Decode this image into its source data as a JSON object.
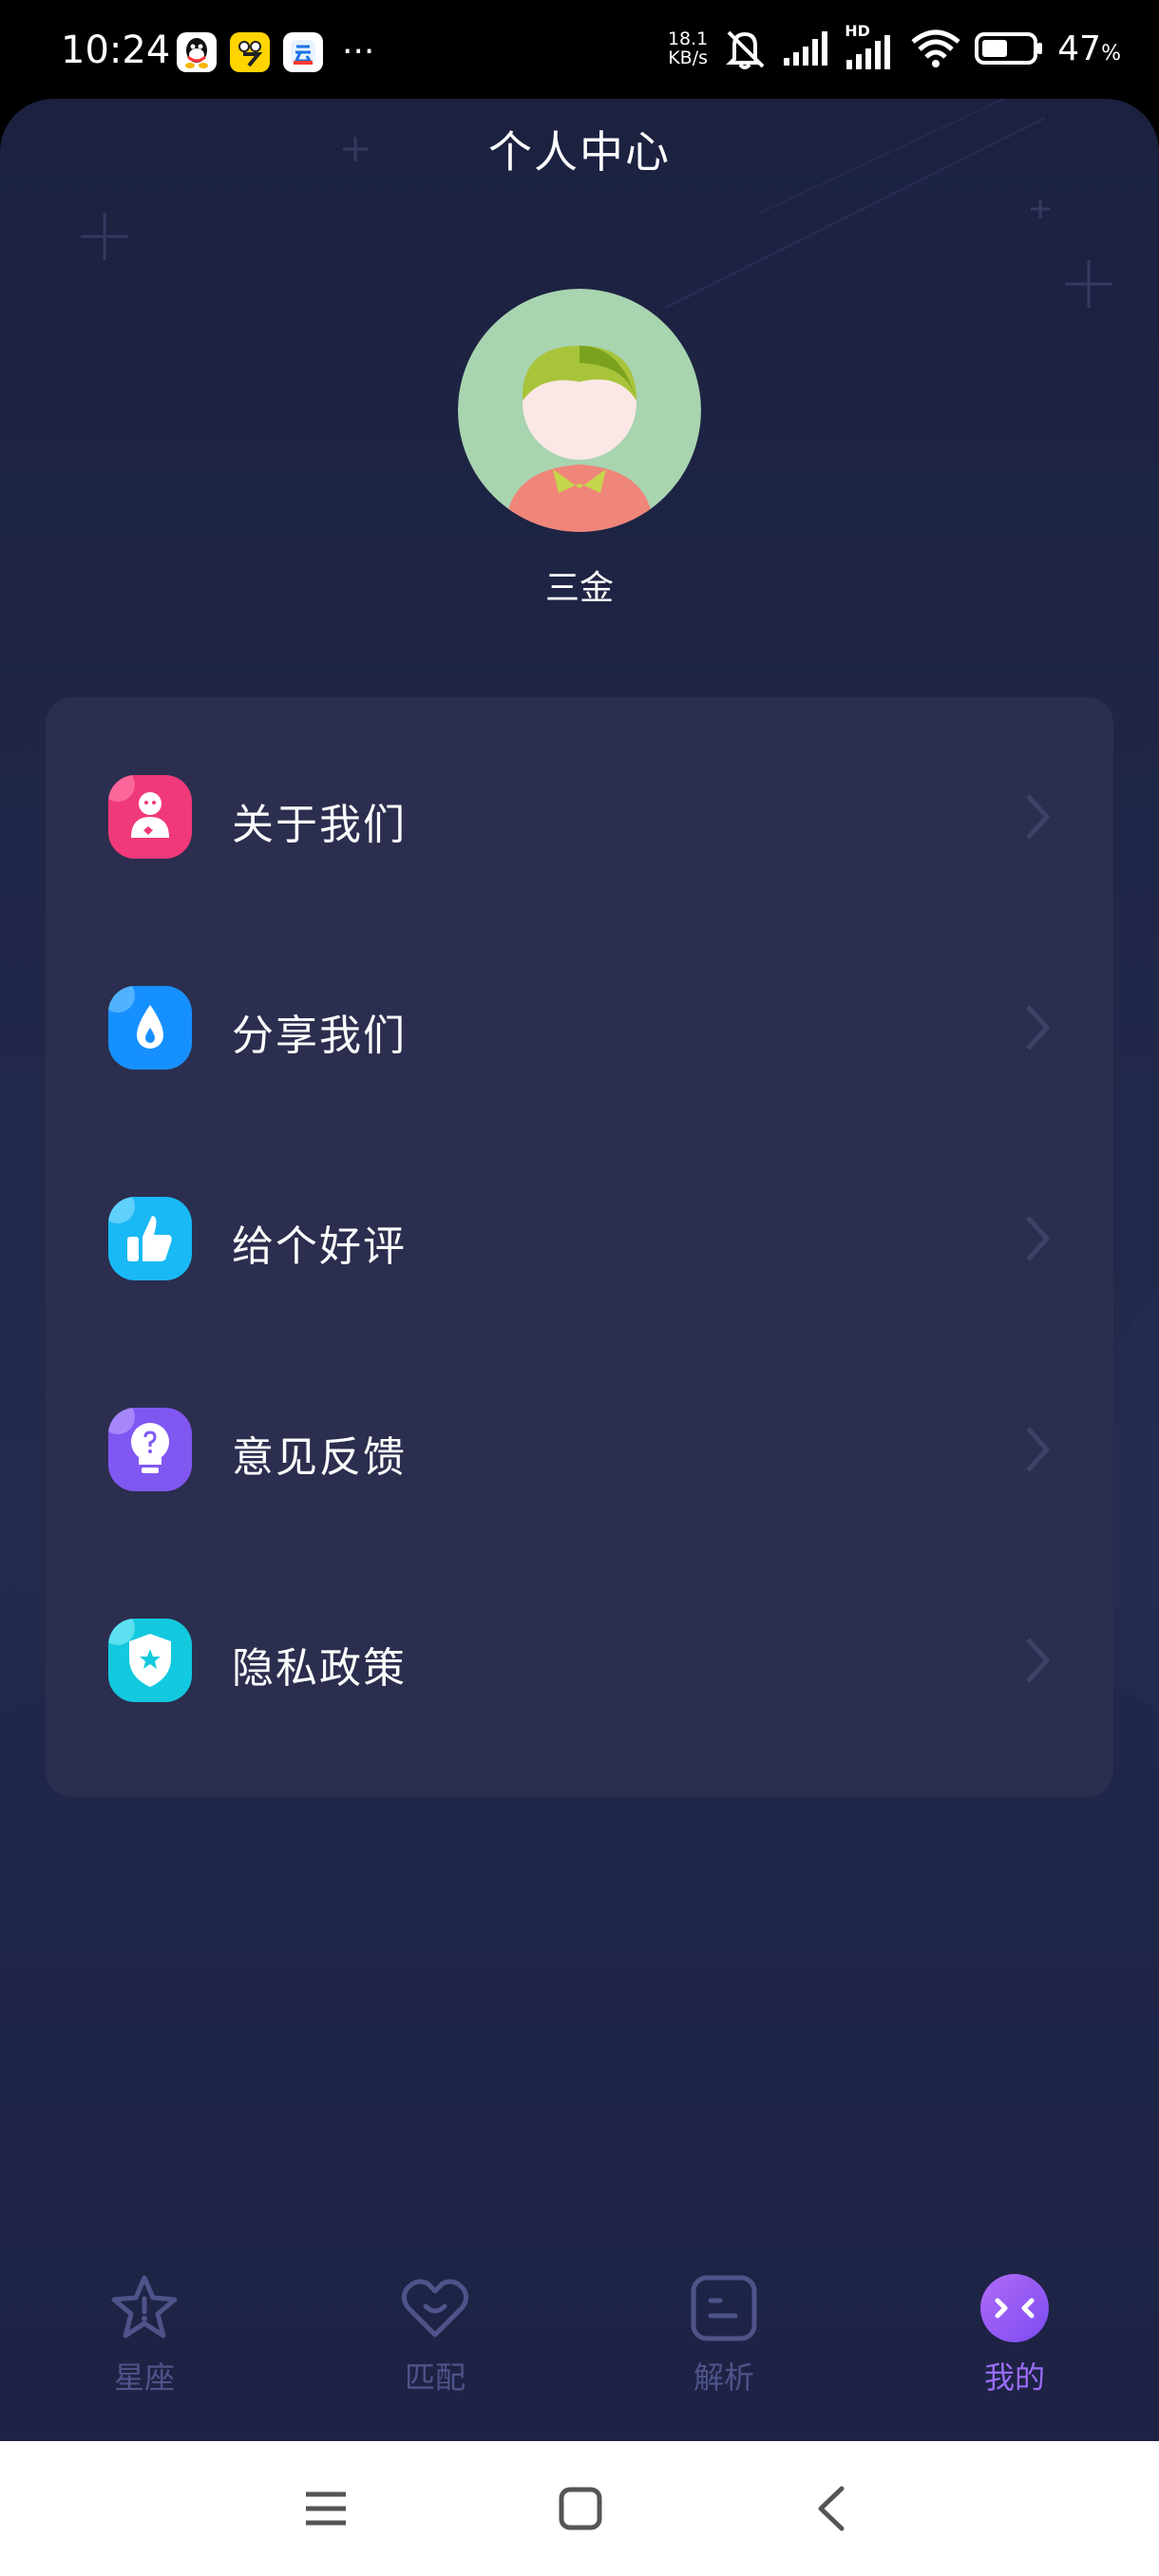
{
  "status_bar": {
    "time": "10:24",
    "speed_value": "18.1",
    "speed_unit": "KB/s",
    "battery_percent": "47",
    "battery_unit": "%",
    "network_badge": "HD",
    "icons": [
      "qq-icon",
      "app-7-icon",
      "app-yun-icon",
      "more-icon",
      "mute-icon",
      "signal-icon",
      "signal-hd-icon",
      "wifi-icon",
      "battery-icon"
    ]
  },
  "header": {
    "title": "个人中心"
  },
  "profile": {
    "username": "三金"
  },
  "menu": {
    "items": [
      {
        "label": "关于我们",
        "icon": "about-us-icon",
        "color": "#f0397a"
      },
      {
        "label": "分享我们",
        "icon": "share-icon",
        "color": "#1790ff"
      },
      {
        "label": "给个好评",
        "icon": "thumbs-up-icon",
        "color": "#19b9f5"
      },
      {
        "label": "意见反馈",
        "icon": "lightbulb-icon",
        "color": "#8157f2"
      },
      {
        "label": "隐私政策",
        "icon": "shield-icon",
        "color": "#13c9df"
      }
    ]
  },
  "tabs": [
    {
      "label": "星座",
      "icon": "star-icon",
      "active": false
    },
    {
      "label": "匹配",
      "icon": "heart-icon",
      "active": false
    },
    {
      "label": "解析",
      "icon": "analysis-icon",
      "active": false
    },
    {
      "label": "我的",
      "icon": "profile-face-icon",
      "active": true
    }
  ],
  "colors": {
    "background": "#1c2140",
    "card": "#2b2e4e",
    "tab_inactive": "#4f5389",
    "tab_active": "#9a6cf6"
  },
  "nav_bar": {
    "icons": [
      "menu-nav-icon",
      "home-nav-icon",
      "back-nav-icon"
    ]
  }
}
